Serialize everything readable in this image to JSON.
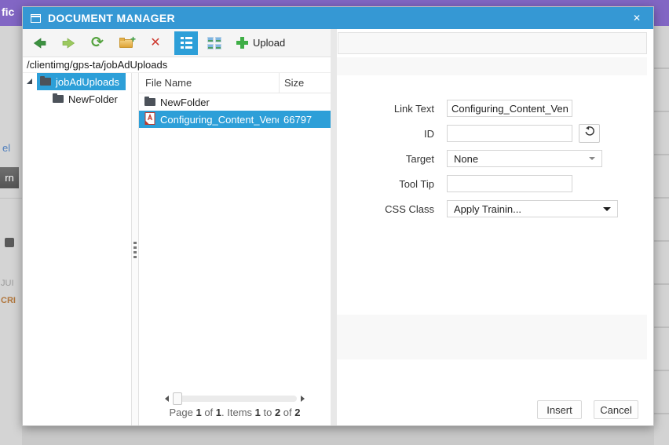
{
  "colors": {
    "titlebar": "#3598d4",
    "selection": "#2d9fd8",
    "purple": "#8266c4",
    "green": "#3c9140",
    "green-light": "#9bc95e",
    "red": "#ce3a30",
    "amber": "#e8b64c"
  },
  "window": {
    "title": "DOCUMENT MANAGER",
    "close_glyph": "✕"
  },
  "toolbar": {
    "refresh_glyph": "⟳",
    "delete_glyph": "✕",
    "newfolder_plus": "+",
    "upload_label": "Upload"
  },
  "path": "/clientimg/gps-ta/jobAdUploads",
  "tree": {
    "items": [
      {
        "label": "jobAdUploads"
      },
      {
        "label": "NewFolder"
      }
    ]
  },
  "files": {
    "headers": [
      "File Name",
      "Size"
    ],
    "rows": [
      {
        "name": "NewFolder",
        "size": ""
      },
      {
        "name": "Configuring_Content_Vendo",
        "size": "66797"
      }
    ]
  },
  "pager": {
    "parts": [
      "Page ",
      "1",
      " of ",
      "1",
      ". Items ",
      "1",
      " to ",
      "2",
      " of ",
      "2"
    ]
  },
  "form": {
    "fields": [
      {
        "label": "Link Text",
        "value": "Configuring_Content_Vendor"
      },
      {
        "label": "ID",
        "value": ""
      },
      {
        "label": "Target",
        "value": "None"
      },
      {
        "label": "Tool Tip",
        "value": ""
      },
      {
        "label": "CSS Class",
        "value": "Apply Trainin..."
      }
    ]
  },
  "actions": {
    "insert": "Insert",
    "cancel": "Cancel"
  },
  "background": {
    "top_text": "fic",
    "link_fragment": "el",
    "button_fragment": "rn",
    "label_1": "JUI",
    "label_2": "CRI"
  }
}
